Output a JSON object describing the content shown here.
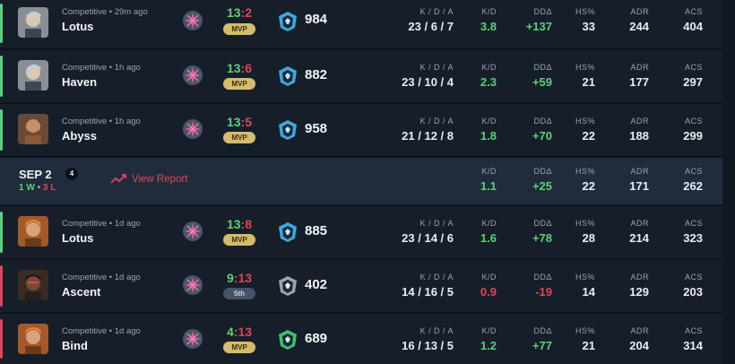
{
  "colors": {
    "win": "#5bd17a",
    "loss": "#e0455a",
    "mvp": "#d4bc6a",
    "row_bg": "#161e29",
    "summary_bg": "#202c3b"
  },
  "labels": {
    "kda": "K / D / A",
    "kd": "K/D",
    "dd": "DDΔ",
    "hs": "HS%",
    "adr": "ADR",
    "acs": "ACS"
  },
  "matches_before": [
    {
      "mode": "Competitive • 29m ago",
      "map": "Lotus",
      "score_a": "13",
      "score_sep": ":",
      "score_b": "2",
      "result": "win",
      "badge": "MVP",
      "badge_type": "mvp",
      "agent_icon": "agent-icon",
      "rank_icon": "rank-icon",
      "rr": "984",
      "kda": "23 / 6 / 7",
      "kd": "3.8",
      "dd": "+137",
      "hs": "33",
      "adr": "244",
      "acs": "404"
    },
    {
      "mode": "Competitive • 1h ago",
      "map": "Haven",
      "score_a": "13",
      "score_sep": ":",
      "score_b": "6",
      "result": "win",
      "badge": "MVP",
      "badge_type": "mvp",
      "agent_icon": "agent-icon",
      "rank_icon": "rank-icon",
      "rr": "882",
      "kda": "23 / 10 / 4",
      "kd": "2.3",
      "dd": "+59",
      "hs": "21",
      "adr": "177",
      "acs": "297"
    },
    {
      "mode": "Competitive • 1h ago",
      "map": "Abyss",
      "score_a": "13",
      "score_sep": ":",
      "score_b": "5",
      "result": "win",
      "badge": "MVP",
      "badge_type": "mvp",
      "agent_icon": "agent-icon",
      "rank_icon": "rank-icon",
      "rr": "958",
      "kda": "21 / 12 / 8",
      "kd": "1.8",
      "dd": "+70",
      "hs": "22",
      "adr": "188",
      "acs": "299"
    }
  ],
  "summary": {
    "date": "SEP 2",
    "count": "4",
    "wins": "1",
    "wins_suffix": "W",
    "dot": "•",
    "losses": "3",
    "losses_suffix": "L",
    "report_label": "View Report",
    "kd": "1.1",
    "dd": "+25",
    "hs": "22",
    "adr": "171",
    "acs": "262"
  },
  "matches_after": [
    {
      "mode": "Competitive • 1d ago",
      "map": "Lotus",
      "score_a": "13",
      "score_sep": ":",
      "score_b": "8",
      "result": "win",
      "badge": "MVP",
      "badge_type": "mvp",
      "agent_icon": "agent-icon",
      "rank_icon": "rank-icon",
      "rr": "885",
      "kda": "23 / 14 / 6",
      "kd": "1.6",
      "dd": "+78",
      "hs": "28",
      "adr": "214",
      "acs": "323"
    },
    {
      "mode": "Competitive • 1d ago",
      "map": "Ascent",
      "score_a": "9",
      "score_sep": ":",
      "score_b": "13",
      "result": "loss",
      "badge": "5th",
      "badge_type": "place",
      "agent_icon": "agent-icon",
      "rank_icon": "rank-icon",
      "rr": "402",
      "kda": "14 / 16 / 5",
      "kd": "0.9",
      "dd": "-19",
      "hs": "14",
      "adr": "129",
      "acs": "203"
    },
    {
      "mode": "Competitive • 1d ago",
      "map": "Bind",
      "score_a": "4",
      "score_sep": ":",
      "score_b": "13",
      "result": "loss",
      "badge": "MVP",
      "badge_type": "mvp",
      "agent_icon": "agent-icon",
      "rank_icon": "rank-icon",
      "rr": "689",
      "kda": "16 / 13 / 5",
      "kd": "1.2",
      "dd": "+77",
      "hs": "21",
      "adr": "204",
      "acs": "314"
    }
  ]
}
